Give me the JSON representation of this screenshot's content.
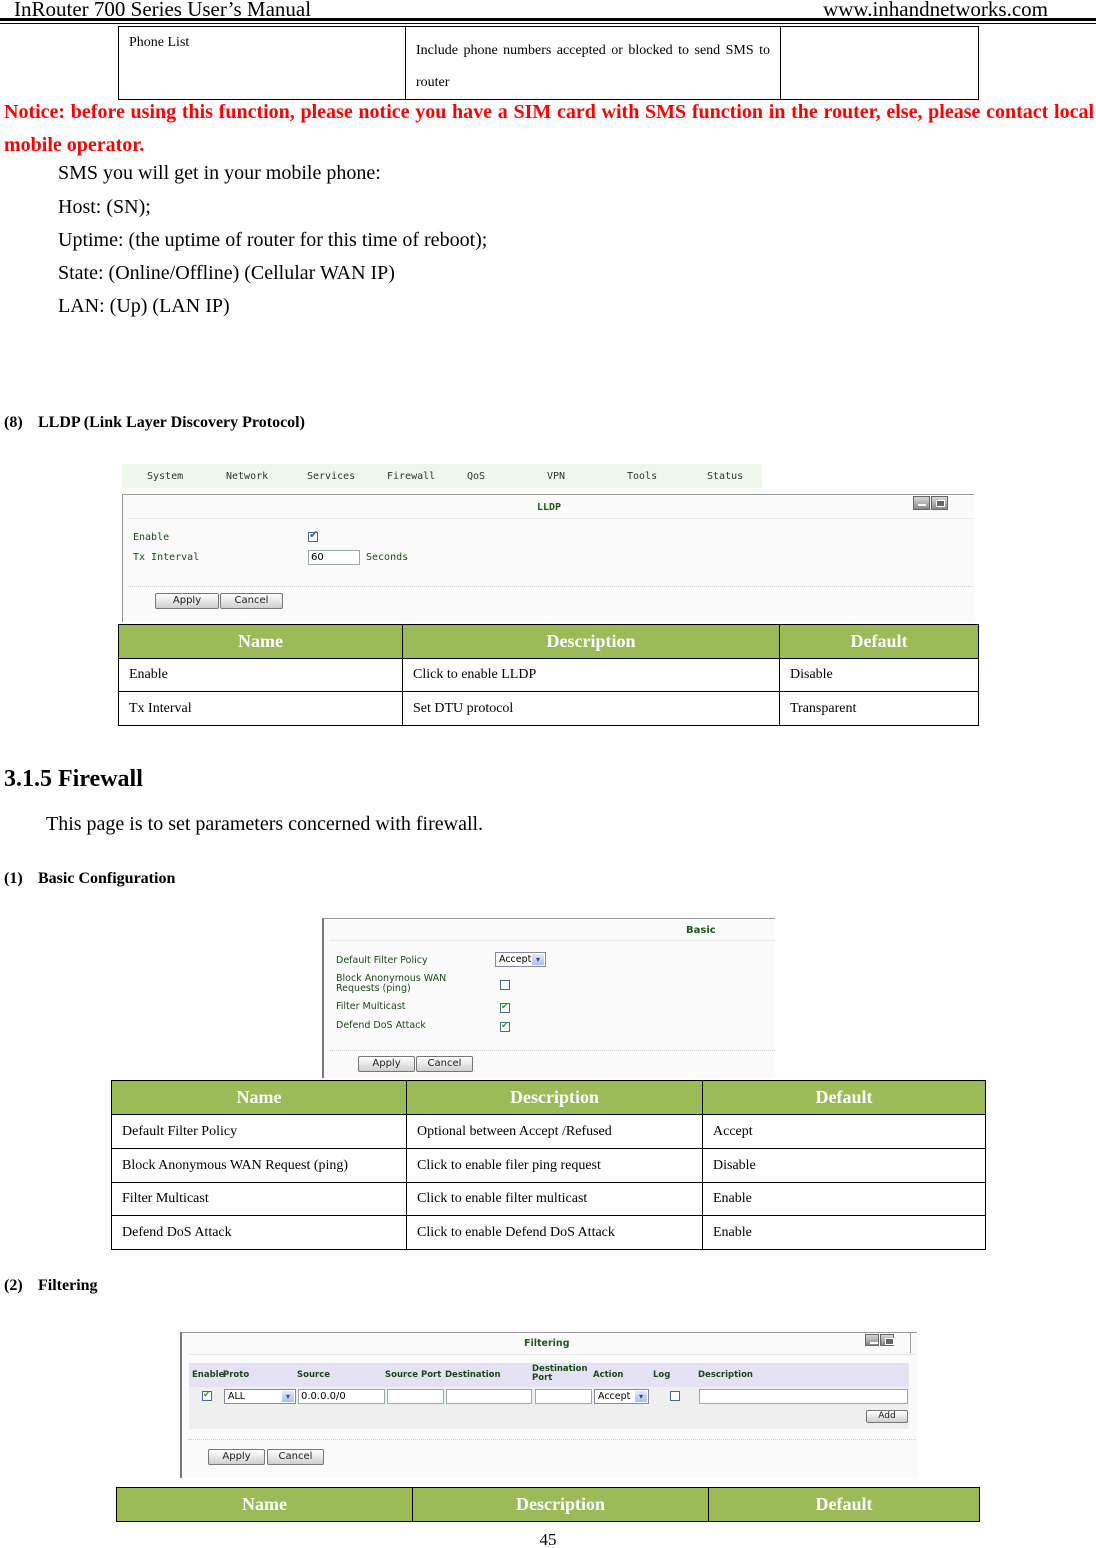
{
  "header": {
    "title": "InRouter 700 Series User’s Manual",
    "url": "www.inhandnetworks.com"
  },
  "top_table": {
    "rows": [
      [
        "Phone List",
        "Include phone numbers accepted or blocked to send SMS to router",
        ""
      ]
    ]
  },
  "notice": "Notice: before using this function, please notice you have a SIM card with SMS function in the router, else, please contact local mobile operator.",
  "sms_lines": [
    "SMS you will get in your mobile phone:",
    "Host: (SN);",
    "Uptime: (the uptime of router for this time of reboot);",
    "State: (Online/Offline) (Cellular WAN IP)",
    "LAN: (Up) (LAN IP)"
  ],
  "lldp": {
    "heading_num": "(8)",
    "heading": "LLDP (Link Layer Discovery Protocol)",
    "nav": [
      "System",
      "Network",
      "Services",
      "Firewall",
      "QoS",
      "VPN",
      "Tools",
      "Status"
    ],
    "panel_title": "LLDP",
    "enable_label": "Enable",
    "enable_checked": true,
    "tx_label": "Tx Interval",
    "tx_value": "60",
    "tx_unit": "Seconds",
    "apply": "Apply",
    "cancel": "Cancel",
    "table": {
      "headers": [
        "Name",
        "Description",
        "Default"
      ],
      "rows": [
        [
          "Enable",
          "Click to enable LLDP",
          "Disable"
        ],
        [
          "Tx Interval",
          "Set DTU protocol",
          "Transparent"
        ]
      ]
    }
  },
  "firewall": {
    "title": "3.1.5 Firewall",
    "intro": "This page is to set parameters concerned with firewall.",
    "basic": {
      "heading_num": "(1)",
      "heading": "Basic Configuration",
      "panel_title": "Basic",
      "policy_label": "Default Filter Policy",
      "policy_value": "Accept",
      "block_label": "Block Anonymous WAN Requests (ping)",
      "block_checked": false,
      "multicast_label": "Filter Multicast",
      "multicast_checked": true,
      "dos_label": "Defend DoS Attack",
      "dos_checked": true,
      "apply": "Apply",
      "cancel": "Cancel",
      "table": {
        "headers": [
          "Name",
          "Description",
          "Default"
        ],
        "rows": [
          [
            "Default Filter Policy",
            "Optional between Accept /Refused",
            "Accept"
          ],
          [
            "Block Anonymous WAN Request (ping)",
            "Click to enable filer ping request",
            "Disable"
          ],
          [
            "Filter Multicast",
            "Click to enable filter multicast",
            "Enable"
          ],
          [
            "Defend DoS Attack",
            "Click to enable Defend DoS Attack",
            "Enable"
          ]
        ]
      }
    },
    "filtering": {
      "heading_num": "(2)",
      "heading": "Filtering",
      "panel_title": "Filtering",
      "columns": [
        "Enable",
        "Proto",
        "Source",
        "Source Port",
        "Destination",
        "Destination Port",
        "Action",
        "Log",
        "Description"
      ],
      "row": {
        "enable_checked": true,
        "proto": "ALL",
        "source": "0.0.0.0/0",
        "source_port": "",
        "destination": "",
        "destination_port": "",
        "action": "Accept",
        "log_checked": false,
        "description": ""
      },
      "add": "Add",
      "apply": "Apply",
      "cancel": "Cancel",
      "table": {
        "headers": [
          "Name",
          "Description",
          "Default"
        ]
      }
    }
  },
  "page_number": "45"
}
